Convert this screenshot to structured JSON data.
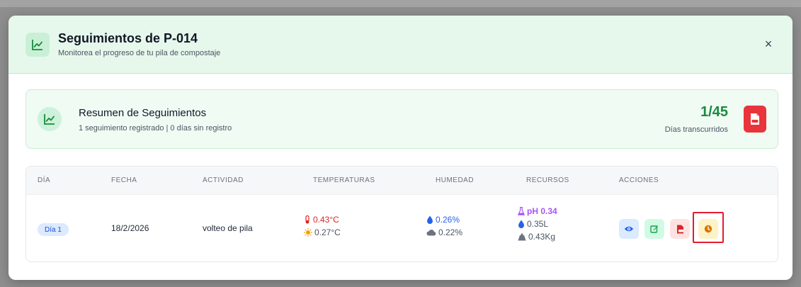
{
  "header": {
    "title": "Seguimientos de P-014",
    "subtitle": "Monitorea el progreso de tu pila de compostaje",
    "close_label": "×"
  },
  "summary": {
    "title": "Resumen de Seguimientos",
    "subtitle": "1 seguimiento registrado | 0 días sin registro",
    "count": "1/45",
    "count_label": "Días transcurridos"
  },
  "table": {
    "headers": [
      "DÍA",
      "FECHA",
      "ACTIVIDAD",
      "TEMPERATURAS",
      "HUMEDAD",
      "RECURSOS",
      "ACCIONES"
    ],
    "rows": [
      {
        "day": "Día 1",
        "date": "18/2/2026",
        "activity": "volteo de pila",
        "temp_internal": "0.43°C",
        "temp_ambient": "0.27°C",
        "humidity_pile": "0.26%",
        "humidity_ambient": "0.22%",
        "ph": "pH 0.34",
        "water": "0.35L",
        "weight": "0.43Kg"
      }
    ]
  },
  "icons": {
    "header": "chart-line-icon",
    "summary": "chart-line-icon",
    "pdf": "pdf-file-icon",
    "thermometer": "thermometer-icon",
    "sun": "sun-icon",
    "drop": "water-drop-icon",
    "cloud": "cloud-icon",
    "flask": "flask-icon",
    "weight": "weight-icon",
    "view": "eye-icon",
    "edit": "edit-icon",
    "pdf_row": "pdf-file-icon",
    "history": "clock-icon"
  },
  "colors": {
    "header_bg": "#e6f8ec",
    "accent_green": "#1a8a3e",
    "pdf_red": "#e8343a",
    "temp_red": "#dc2626",
    "sun_orange": "#f59e0b",
    "humidity_blue": "#2563eb",
    "ph_purple": "#a855f7",
    "highlight_red": "#e11d2f"
  }
}
